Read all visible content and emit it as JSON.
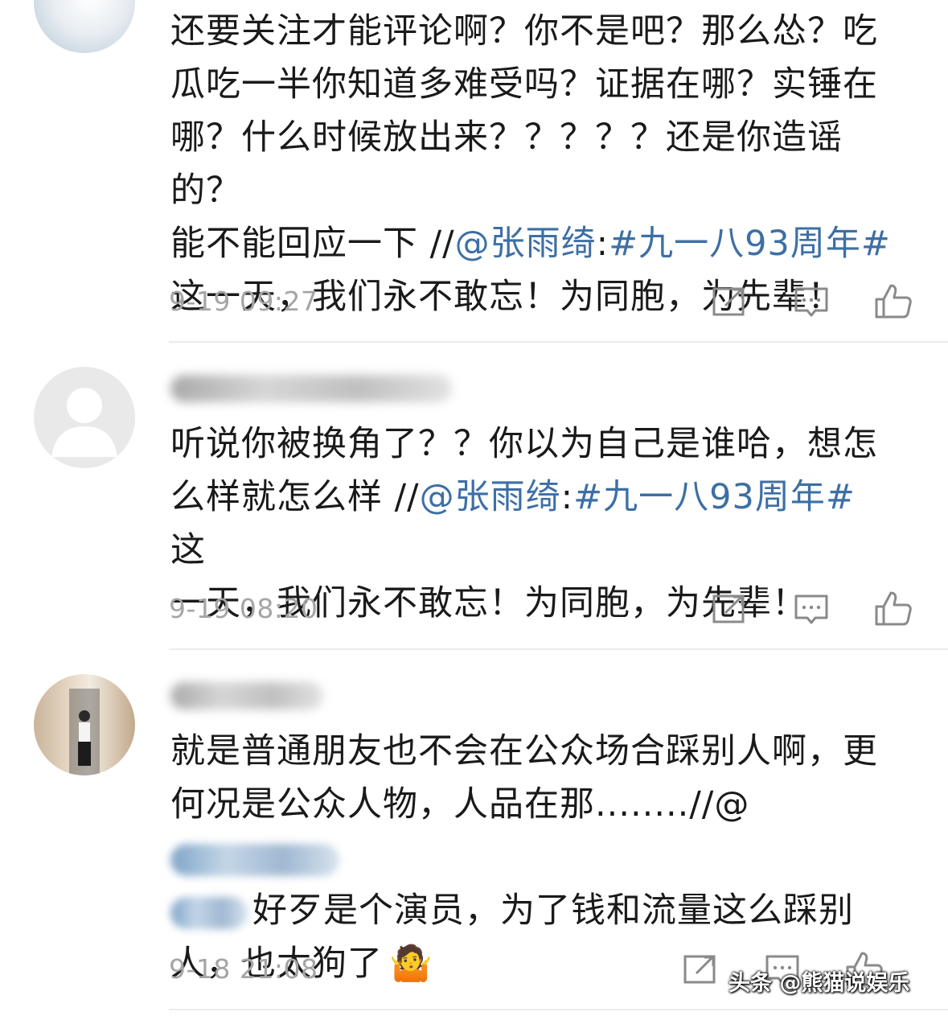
{
  "comments": [
    {
      "text_lines": [
        "还要关注才能评论啊？你不是吧？那么怂？吃",
        "瓜吃一半你知道多难受吗？证据在哪？实锤在",
        "哪？什么时候放出来？？？？？还是你造谣的？"
      ],
      "line4_prefix": "能不能回应一下 //",
      "mention": "@张雨绮",
      "colon": ":",
      "hashtag": "#九一八93周年#",
      "tail": "这一天，我们永不敢忘！为同胞，为先辈！",
      "time": "9-19 09:27"
    },
    {
      "line1": "听说你被换角了？？你以为自己是谁哈，想怎",
      "line2_prefix": "么样就怎么样 //",
      "mention": "@张雨绮",
      "colon": ":",
      "hashtag": "#九一八93周年#",
      "line2_suffix": " 这",
      "line3": "一天，我们永不敢忘！为同胞，为先辈！",
      "time": "9-19 08:20"
    },
    {
      "line1": "就是普通朋友也不会在公众场合踩别人啊，更",
      "line2": "何况是公众人物，人品在那........//@",
      "line3": "好歹是个演员，为了钱和流量这么踩别",
      "line4": "人，也太狗了",
      "emoji": "🤷",
      "time": "9-18 21:08"
    }
  ],
  "icons": {
    "share": "share-icon",
    "comment": "comment-icon",
    "like": "like-icon"
  },
  "colors": {
    "link": "#3d6fa5",
    "text": "#1a1a1a",
    "meta": "#a5a5a5",
    "divider": "#ececec"
  },
  "watermark": "头条 @熊猫说娱乐"
}
